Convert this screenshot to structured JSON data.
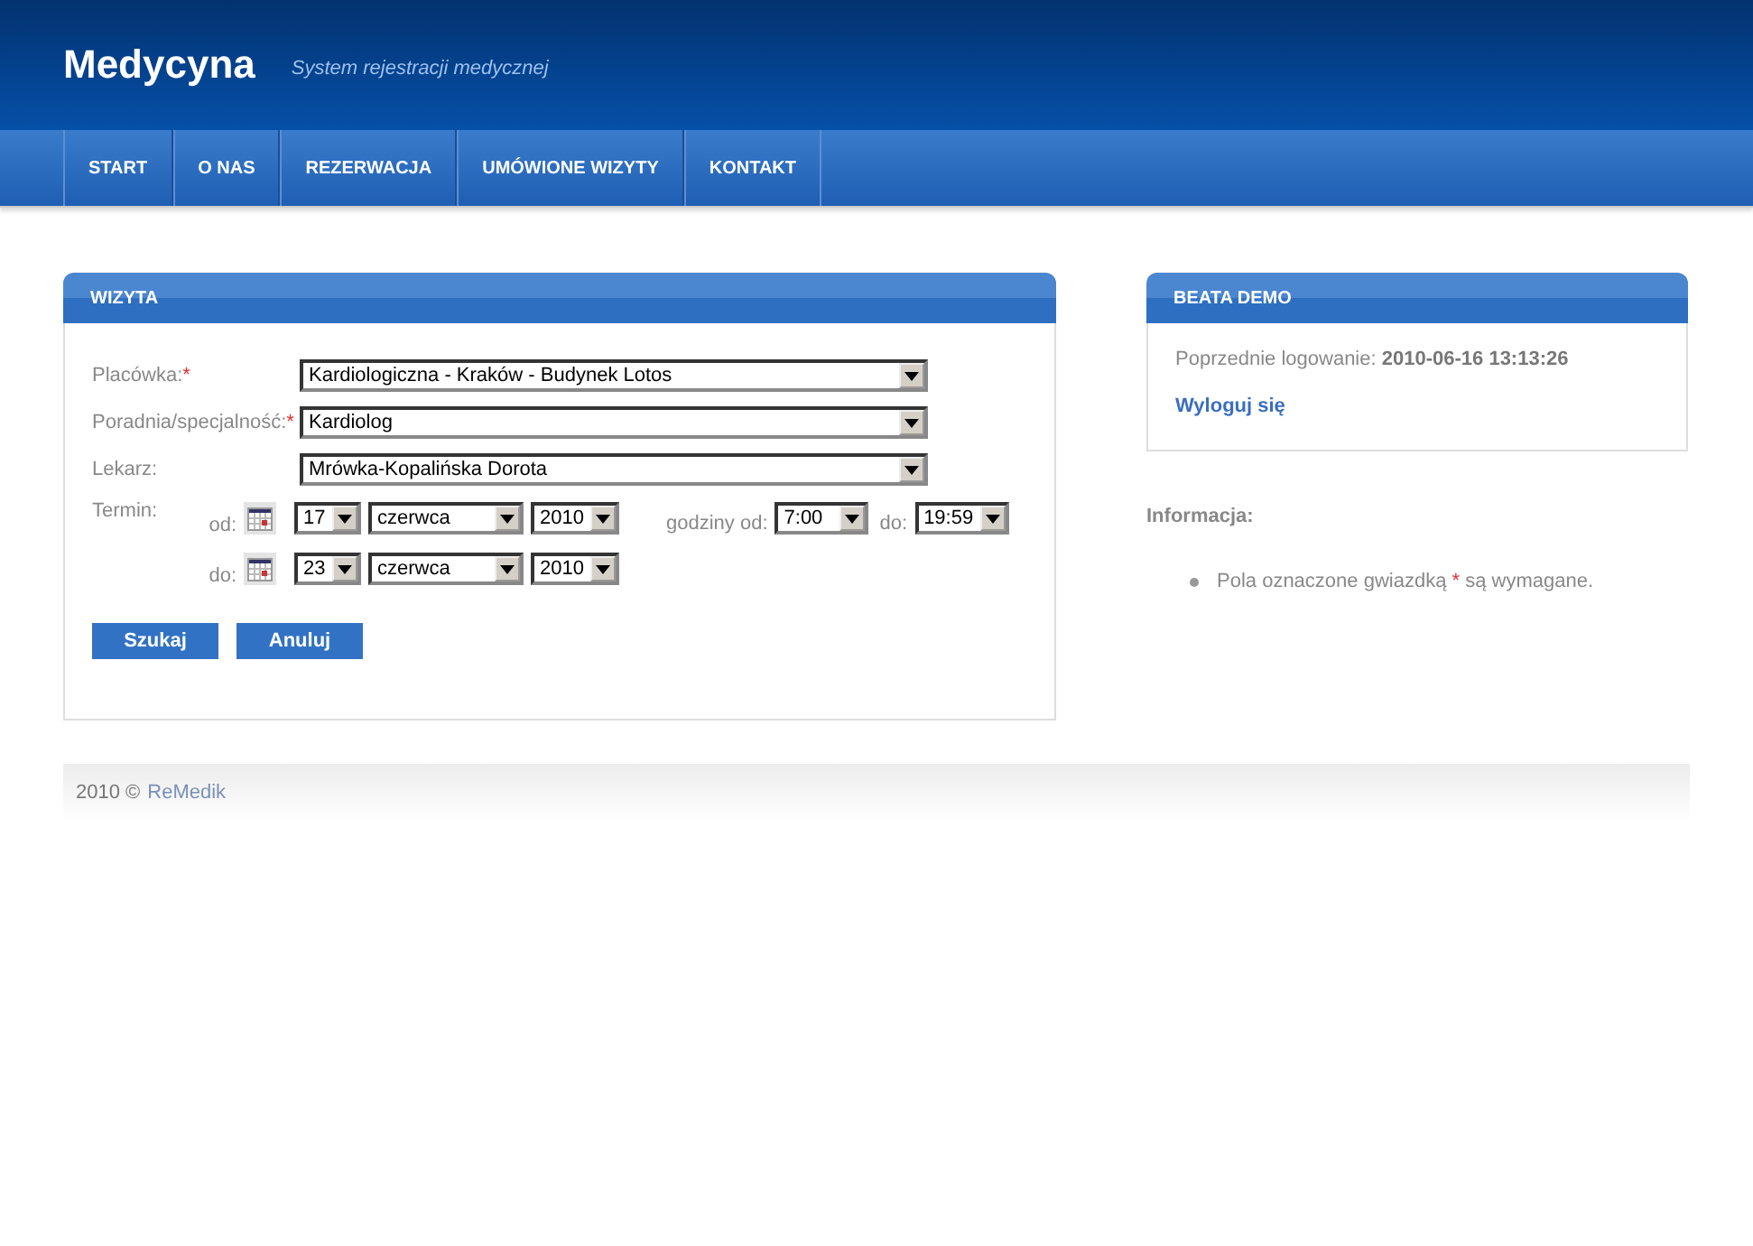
{
  "header": {
    "title": "Medycyna",
    "subtitle": "System rejestracji medycznej"
  },
  "nav": [
    {
      "label": "START"
    },
    {
      "label": "O NAS"
    },
    {
      "label": "REZERWACJA"
    },
    {
      "label": "UMÓWIONE WIZYTY"
    },
    {
      "label": "KONTAKT"
    }
  ],
  "visit_panel": {
    "title": "WIZYTA",
    "fields": [
      {
        "label": "Placówka:",
        "mark": "*",
        "value": "Kardiologiczna - Kraków - Budynek Lotos"
      },
      {
        "label": "Poradnia/specjalność:",
        "mark": "*",
        "value": "Kardiolog"
      },
      {
        "label": "Lekarz:",
        "value": "Mrówka-Kopalińska Dorota"
      }
    ],
    "term": {
      "label": "Termin:",
      "rows": [
        {
          "label": "od:",
          "day": "17",
          "month": "czerwca",
          "year": "2010",
          "hours": {
            "label": "godziny od:",
            "from": "7:00",
            "to_label": "do:",
            "to": "19:59"
          }
        },
        {
          "label": "do:",
          "day": "23",
          "month": "czerwca",
          "year": "2010"
        }
      ]
    },
    "buttons": [
      "Szukaj",
      "Anuluj"
    ]
  },
  "user_panel": {
    "title": "BEATA DEMO",
    "last_login_label": "Poprzednie logowanie:",
    "last_login": "2010-06-16 13:13:26",
    "logout": "Wyloguj się"
  },
  "info": {
    "title": "Informacja:",
    "items": [
      {
        "before": "Pola oznaczone gwiazdką",
        "mark": "*",
        "after": "są wymagane."
      }
    ]
  },
  "footer": {
    "text": "2010 ©",
    "link": "ReMedik"
  }
}
